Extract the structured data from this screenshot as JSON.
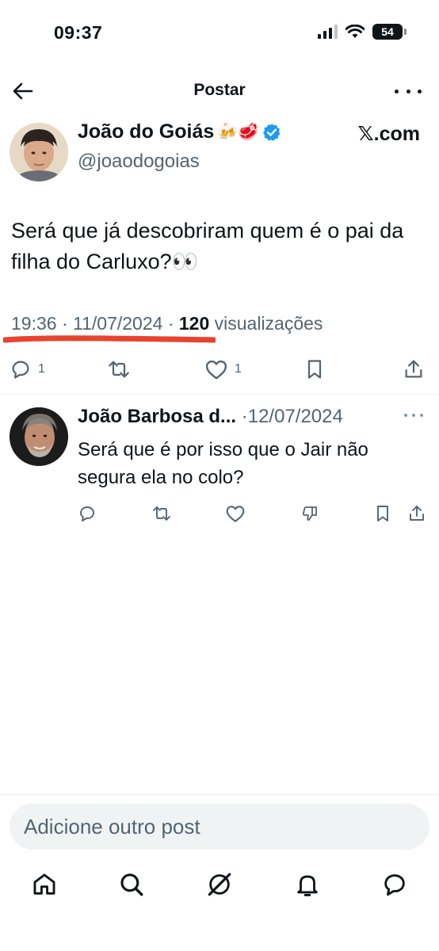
{
  "status_bar": {
    "time": "09:37",
    "battery": "54"
  },
  "header": {
    "title": "Postar"
  },
  "post": {
    "author_name": "João do Goiás",
    "author_emojis": "🍻🥩",
    "handle": "@joaodogoias",
    "source_tag": "𝕏.com",
    "text": "Será que já descobriram quem é o pai da filha do Carluxo?👀",
    "time": "19:36",
    "date": "11/07/2024",
    "views_count": "120",
    "views_label": "visualizações",
    "reply_count": "1",
    "like_count": "1"
  },
  "reply": {
    "author_name": "João Barbosa d...",
    "date": "12/07/2024",
    "text": "Será que é por isso que o Jair não segura ela no colo?"
  },
  "compose": {
    "placeholder": "Adicione outro post"
  },
  "colors": {
    "text": "#0f1419",
    "muted": "#536471",
    "verified": "#1d9bf0",
    "annotation": "#e8432f"
  }
}
